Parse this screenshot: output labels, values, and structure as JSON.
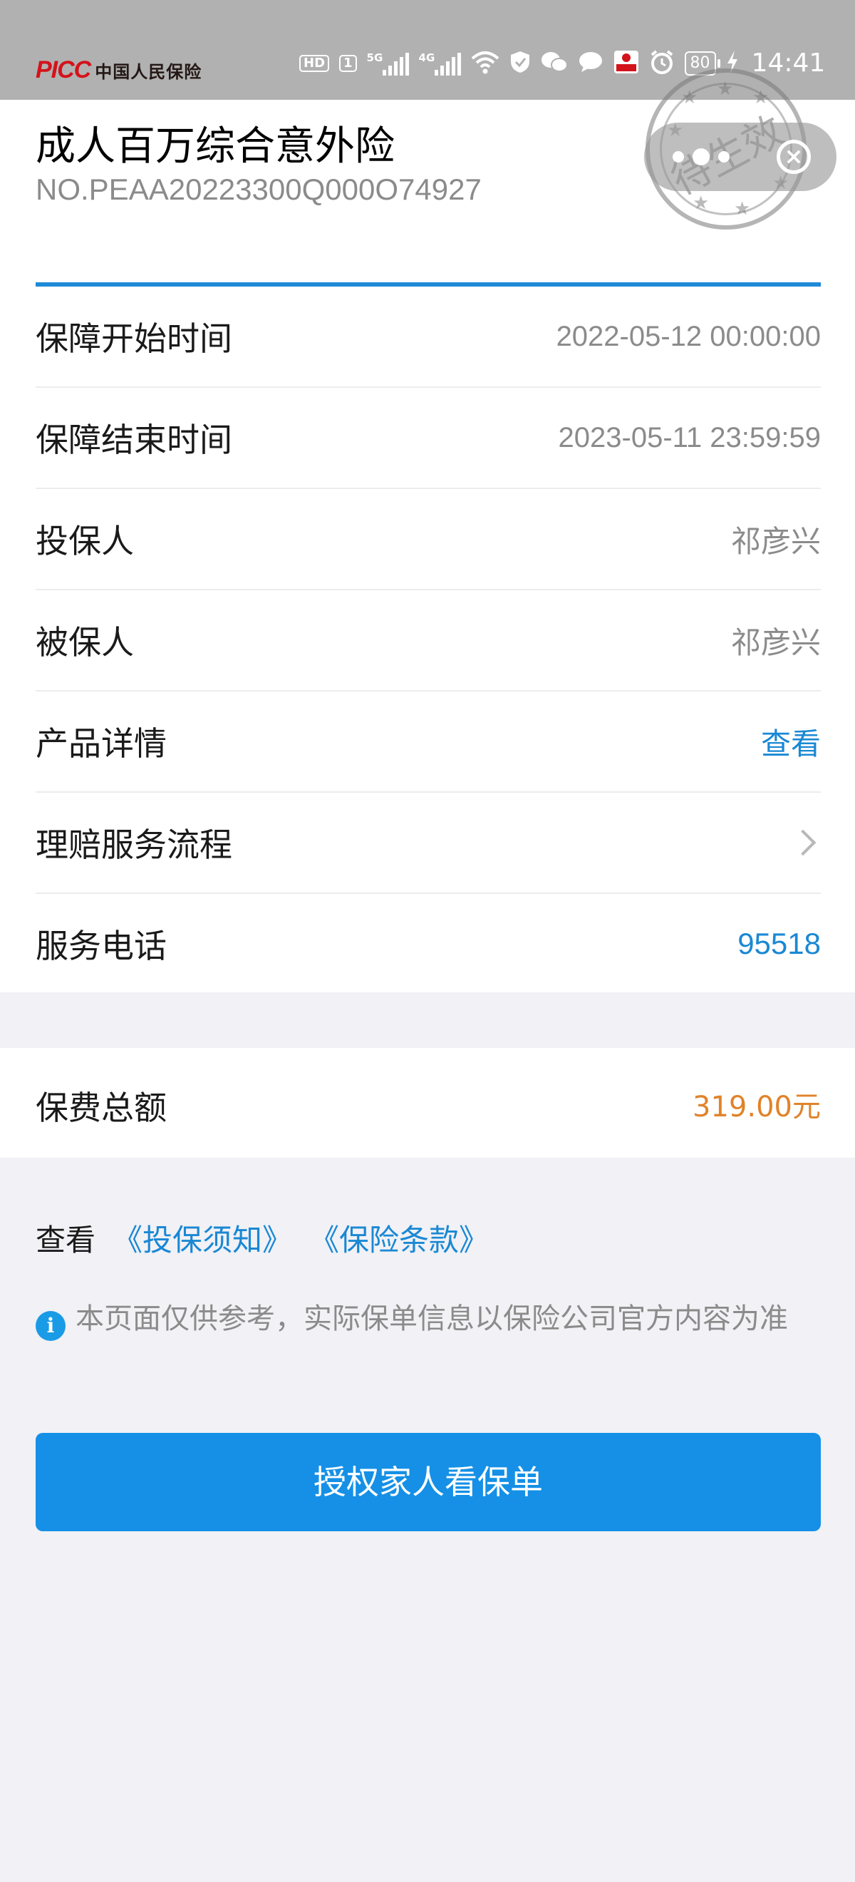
{
  "status_bar": {
    "brand_mark": "PICC",
    "brand_name": "中国人民保险",
    "hd": "HD",
    "sim1": "1",
    "sig1_label": "5G",
    "sig2_label": "4G",
    "wifi_label": "6",
    "battery": "80",
    "time": "14:41"
  },
  "policy": {
    "title": "成人百万综合意外险",
    "number": "NO.PEAA20223300Q000O74927"
  },
  "stamp_text": "待生效",
  "rows": [
    {
      "label": "保障开始时间",
      "value": "2022-05-12 00:00:00"
    },
    {
      "label": "保障结束时间",
      "value": "2023-05-11 23:59:59"
    },
    {
      "label": "投保人",
      "value": "祁彦兴"
    },
    {
      "label": "被保人",
      "value": "祁彦兴"
    },
    {
      "label": "产品详情",
      "value": "查看"
    },
    {
      "label": "理赔服务流程",
      "value": ""
    },
    {
      "label": "服务电话",
      "value": "95518"
    }
  ],
  "premium": {
    "label": "保费总额",
    "value": "319.00元"
  },
  "docs": {
    "prefix": "查看",
    "notice_link": "《投保须知》",
    "terms_link": "《保险条款》"
  },
  "notice_text": "本页面仅供参考，实际保单信息以保险公司官方内容为准",
  "authorize_button": "授权家人看保单",
  "colors": {
    "accent_blue": "#1a88d3",
    "button_blue": "#1590e6",
    "premium_orange": "#e0832a",
    "brand_red": "#d4121b"
  }
}
